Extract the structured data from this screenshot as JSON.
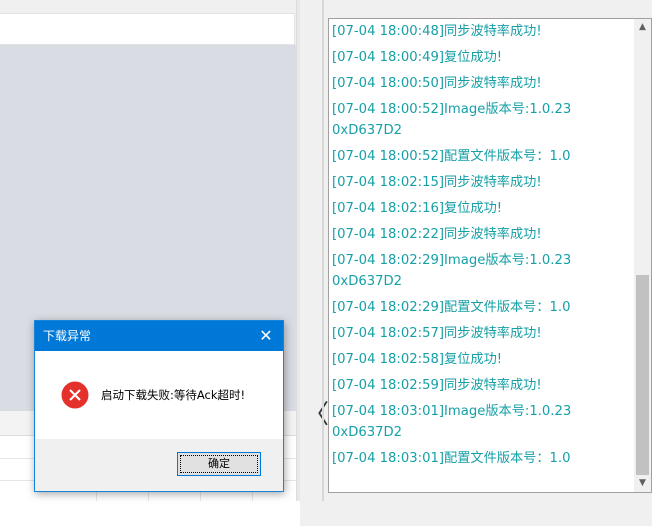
{
  "log": {
    "lines": [
      "[07-04 18:00:48]同步波特率成功!",
      "[07-04 18:00:49]复位成功!",
      "[07-04 18:00:50]同步波特率成功!",
      "[07-04 18:00:52]Image版本号:1.0.23",
      "0xD637D2",
      "[07-04 18:00:52]配置文件版本号：1.0",
      "[07-04 18:02:15]同步波特率成功!",
      "[07-04 18:02:16]复位成功!",
      "[07-04 18:02:22]同步波特率成功!",
      "[07-04 18:02:29]Image版本号:1.0.23",
      "0xD637D2",
      "[07-04 18:02:29]配置文件版本号：1.0",
      "[07-04 18:02:57]同步波特率成功!",
      "[07-04 18:02:58]复位成功!",
      "[07-04 18:02:59]同步波特率成功!",
      "[07-04 18:03:01]Image版本号:1.0.23",
      "0xD637D2",
      "[07-04 18:03:01]配置文件版本号：1.0"
    ],
    "color": "#16a0a6"
  },
  "dialog": {
    "title": "下载异常",
    "message": "启动下载失败:等待Ack超时!",
    "ok_label": "确定",
    "close_glyph": "✕",
    "icon": "error-icon",
    "title_bar_color": "#0078d7"
  },
  "splitter": {
    "arrow_glyph": "〈",
    "icon": "chevron-left-icon"
  },
  "scrollbar": {
    "up_glyph": "▲",
    "down_glyph": "▼"
  }
}
